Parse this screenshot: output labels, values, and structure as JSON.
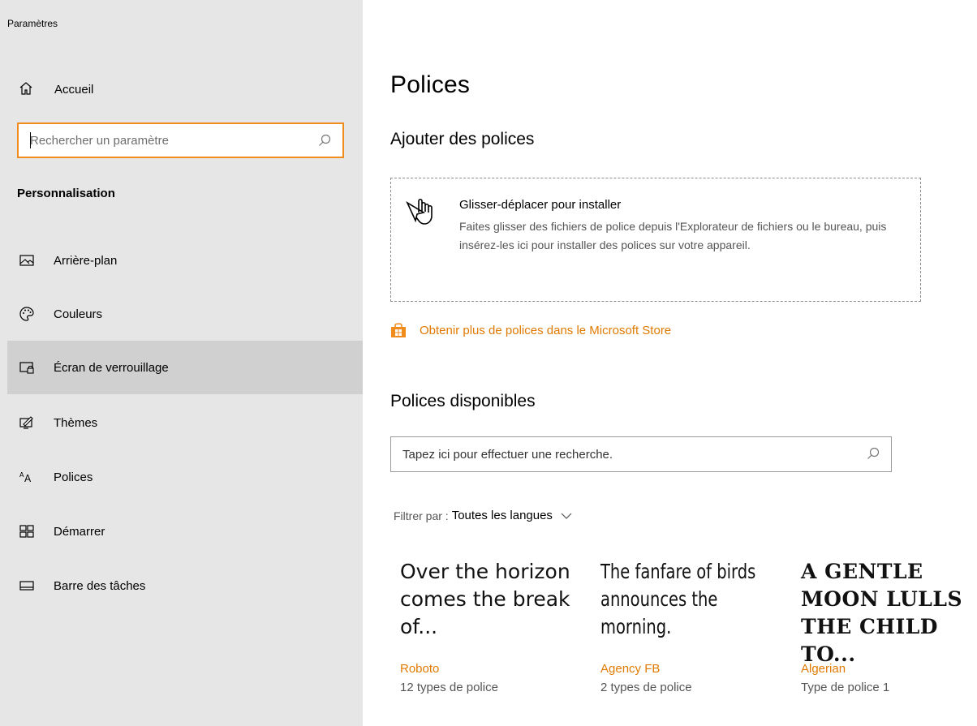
{
  "app": {
    "title": "Paramètres"
  },
  "sidebar": {
    "home_label": "Accueil",
    "search_placeholder": "Rechercher un paramètre",
    "section": "Personnalisation",
    "items": [
      {
        "label": "Arrière-plan",
        "icon": "picture-icon",
        "selected": false
      },
      {
        "label": "Couleurs",
        "icon": "palette-icon",
        "selected": false
      },
      {
        "label": "Écran de verrouillage",
        "icon": "lock-screen-icon",
        "selected": true
      },
      {
        "label": "Thèmes",
        "icon": "themes-icon",
        "selected": false
      },
      {
        "label": "Polices",
        "icon": "fonts-icon",
        "selected": false
      },
      {
        "label": "Démarrer",
        "icon": "start-icon",
        "selected": false
      },
      {
        "label": "Barre des tâches",
        "icon": "taskbar-icon",
        "selected": false
      }
    ]
  },
  "main": {
    "title": "Polices",
    "add_heading": "Ajouter des polices",
    "drop_title": "Glisser-déplacer pour installer",
    "drop_desc": "Faites glisser des fichiers de police depuis l'Explorateur de fichiers ou le bureau, puis insérez-les ici pour installer des polices sur votre appareil.",
    "store_link": "Obtenir plus de polices dans le Microsoft Store",
    "available_heading": "Polices disponibles",
    "search_placeholder": "Tapez ici pour effectuer une recherche.",
    "filter_label": "Filtrer par :",
    "filter_value": "Toutes les langues",
    "fonts": [
      {
        "sample": "Over the horizon comes the break of...",
        "name": "Roboto",
        "count": "12 types de police"
      },
      {
        "sample": "The fanfare of birds announces the morning.",
        "name": "Agency FB",
        "count": "2 types de police"
      },
      {
        "sample": "A gentle moon lulls the child to...",
        "name": "Algerian",
        "count": "Type de police 1"
      }
    ]
  },
  "colors": {
    "accent": "#e07a00",
    "sidebar_bg": "#e6e6e6",
    "selected_bg": "#d0d0d0"
  }
}
